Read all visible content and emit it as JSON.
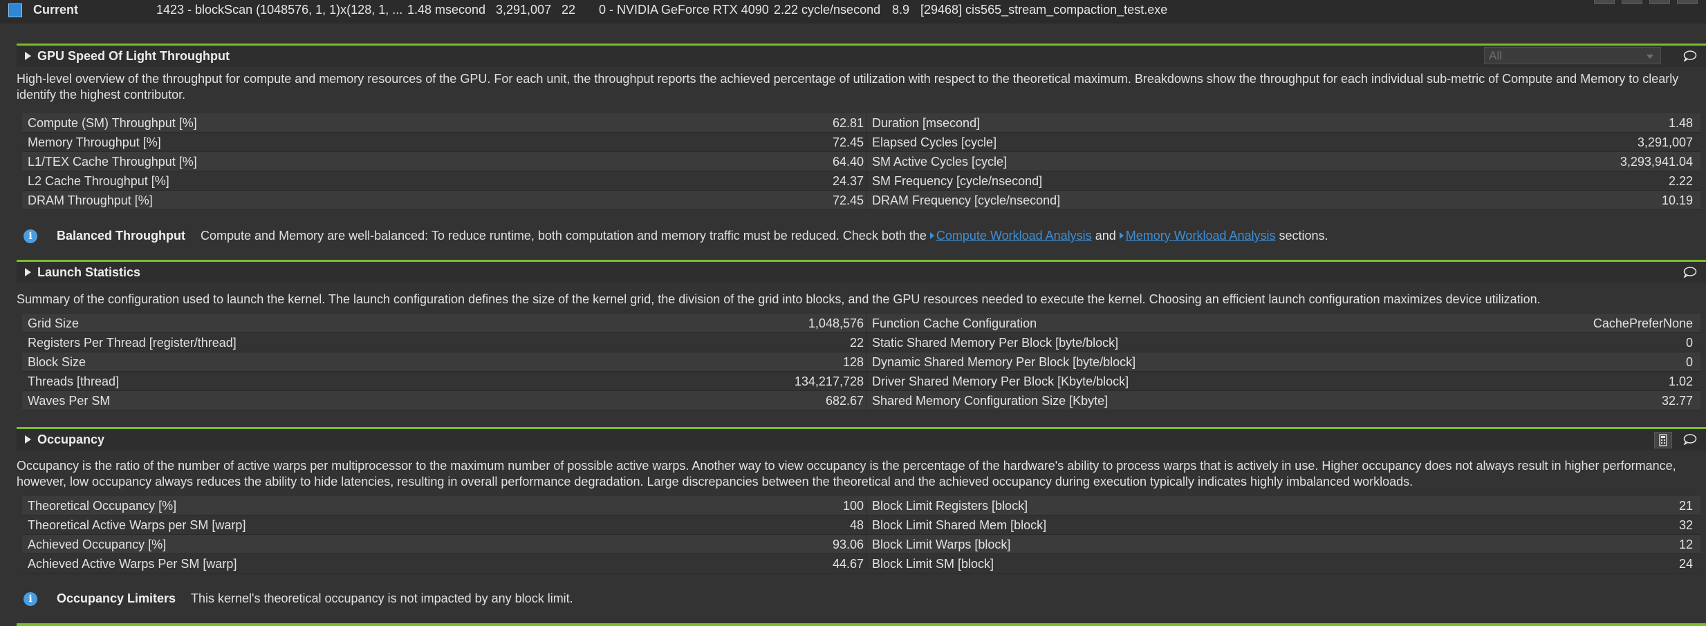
{
  "current_row": {
    "label": "Current",
    "kernel": "1423 - blockScan (1048576, 1, 1)x(128, 1, ...",
    "duration": "1.48 msecond",
    "cycles": "3,291,007",
    "registers": "22",
    "device": "0 - NVIDIA GeForce RTX 4090",
    "frequency": "2.22 cycle/nsecond",
    "cc": "8.9",
    "process": "[29468] cis565_stream_compaction_test.exe"
  },
  "sections": {
    "sol": {
      "title": "GPU Speed Of Light Throughput",
      "dropdown_value": "All",
      "description": "High-level overview of the throughput for compute and memory resources of the GPU. For each unit, the throughput reports the achieved percentage of utilization with respect to the theoretical maximum. Breakdowns show the throughput for each individual sub-metric of Compute and Memory to clearly identify the highest contributor.",
      "rows": [
        {
          "ln": "Compute (SM) Throughput [%]",
          "lv": "62.81",
          "rn": "Duration [msecond]",
          "rv": "1.48"
        },
        {
          "ln": "Memory Throughput [%]",
          "lv": "72.45",
          "rn": "Elapsed Cycles [cycle]",
          "rv": "3,291,007"
        },
        {
          "ln": "L1/TEX Cache Throughput [%]",
          "lv": "64.40",
          "rn": "SM Active Cycles [cycle]",
          "rv": "3,293,941.04"
        },
        {
          "ln": "L2 Cache Throughput [%]",
          "lv": "24.37",
          "rn": "SM Frequency [cycle/nsecond]",
          "rv": "2.22"
        },
        {
          "ln": "DRAM Throughput [%]",
          "lv": "72.45",
          "rn": "DRAM Frequency [cycle/nsecond]",
          "rv": "10.19"
        }
      ],
      "rule": {
        "name": "Balanced Throughput",
        "text_before": "Compute and Memory are well-balanced: To reduce runtime, both computation and memory traffic must be reduced. Check both the",
        "link1": "Compute Workload Analysis",
        "and": "and",
        "link2": "Memory Workload Analysis",
        "text_after": "sections."
      }
    },
    "launch": {
      "title": "Launch Statistics",
      "description": "Summary of the configuration used to launch the kernel. The launch configuration defines the size of the kernel grid, the division of the grid into blocks, and the GPU resources needed to execute the kernel. Choosing an efficient launch configuration maximizes device utilization.",
      "rows": [
        {
          "ln": "Grid Size",
          "lv": "1,048,576",
          "rn": "Function Cache Configuration",
          "rv": "CachePreferNone"
        },
        {
          "ln": "Registers Per Thread [register/thread]",
          "lv": "22",
          "rn": "Static Shared Memory Per Block [byte/block]",
          "rv": "0"
        },
        {
          "ln": "Block Size",
          "lv": "128",
          "rn": "Dynamic Shared Memory Per Block [byte/block]",
          "rv": "0"
        },
        {
          "ln": "Threads [thread]",
          "lv": "134,217,728",
          "rn": "Driver Shared Memory Per Block [Kbyte/block]",
          "rv": "1.02"
        },
        {
          "ln": "Waves Per SM",
          "lv": "682.67",
          "rn": "Shared Memory Configuration Size [Kbyte]",
          "rv": "32.77"
        }
      ]
    },
    "occupancy": {
      "title": "Occupancy",
      "description_line1": "Occupancy is the ratio of the number of active warps per multiprocessor to the maximum number of possible active warps. Another way to view occupancy is the percentage of the hardware's ability to process warps that is actively in use. Higher occupancy does not always result in higher performance,",
      "description_line2": "however, low occupancy always reduces the ability to hide latencies, resulting in overall performance degradation. Large discrepancies between the theoretical and the achieved occupancy during execution typically indicates highly imbalanced workloads.",
      "rows": [
        {
          "ln": "Theoretical Occupancy [%]",
          "lv": "100",
          "rn": "Block Limit Registers [block]",
          "rv": "21"
        },
        {
          "ln": "Theoretical Active Warps per SM [warp]",
          "lv": "48",
          "rn": "Block Limit Shared Mem [block]",
          "rv": "32"
        },
        {
          "ln": "Achieved Occupancy [%]",
          "lv": "93.06",
          "rn": "Block Limit Warps [block]",
          "rv": "12"
        },
        {
          "ln": "Achieved Active Warps Per SM [warp]",
          "lv": "44.67",
          "rn": "Block Limit SM [block]",
          "rv": "24"
        }
      ],
      "rule": {
        "name": "Occupancy Limiters",
        "text": "This kernel's theoretical occupancy is not impacted by any block limit."
      }
    }
  }
}
